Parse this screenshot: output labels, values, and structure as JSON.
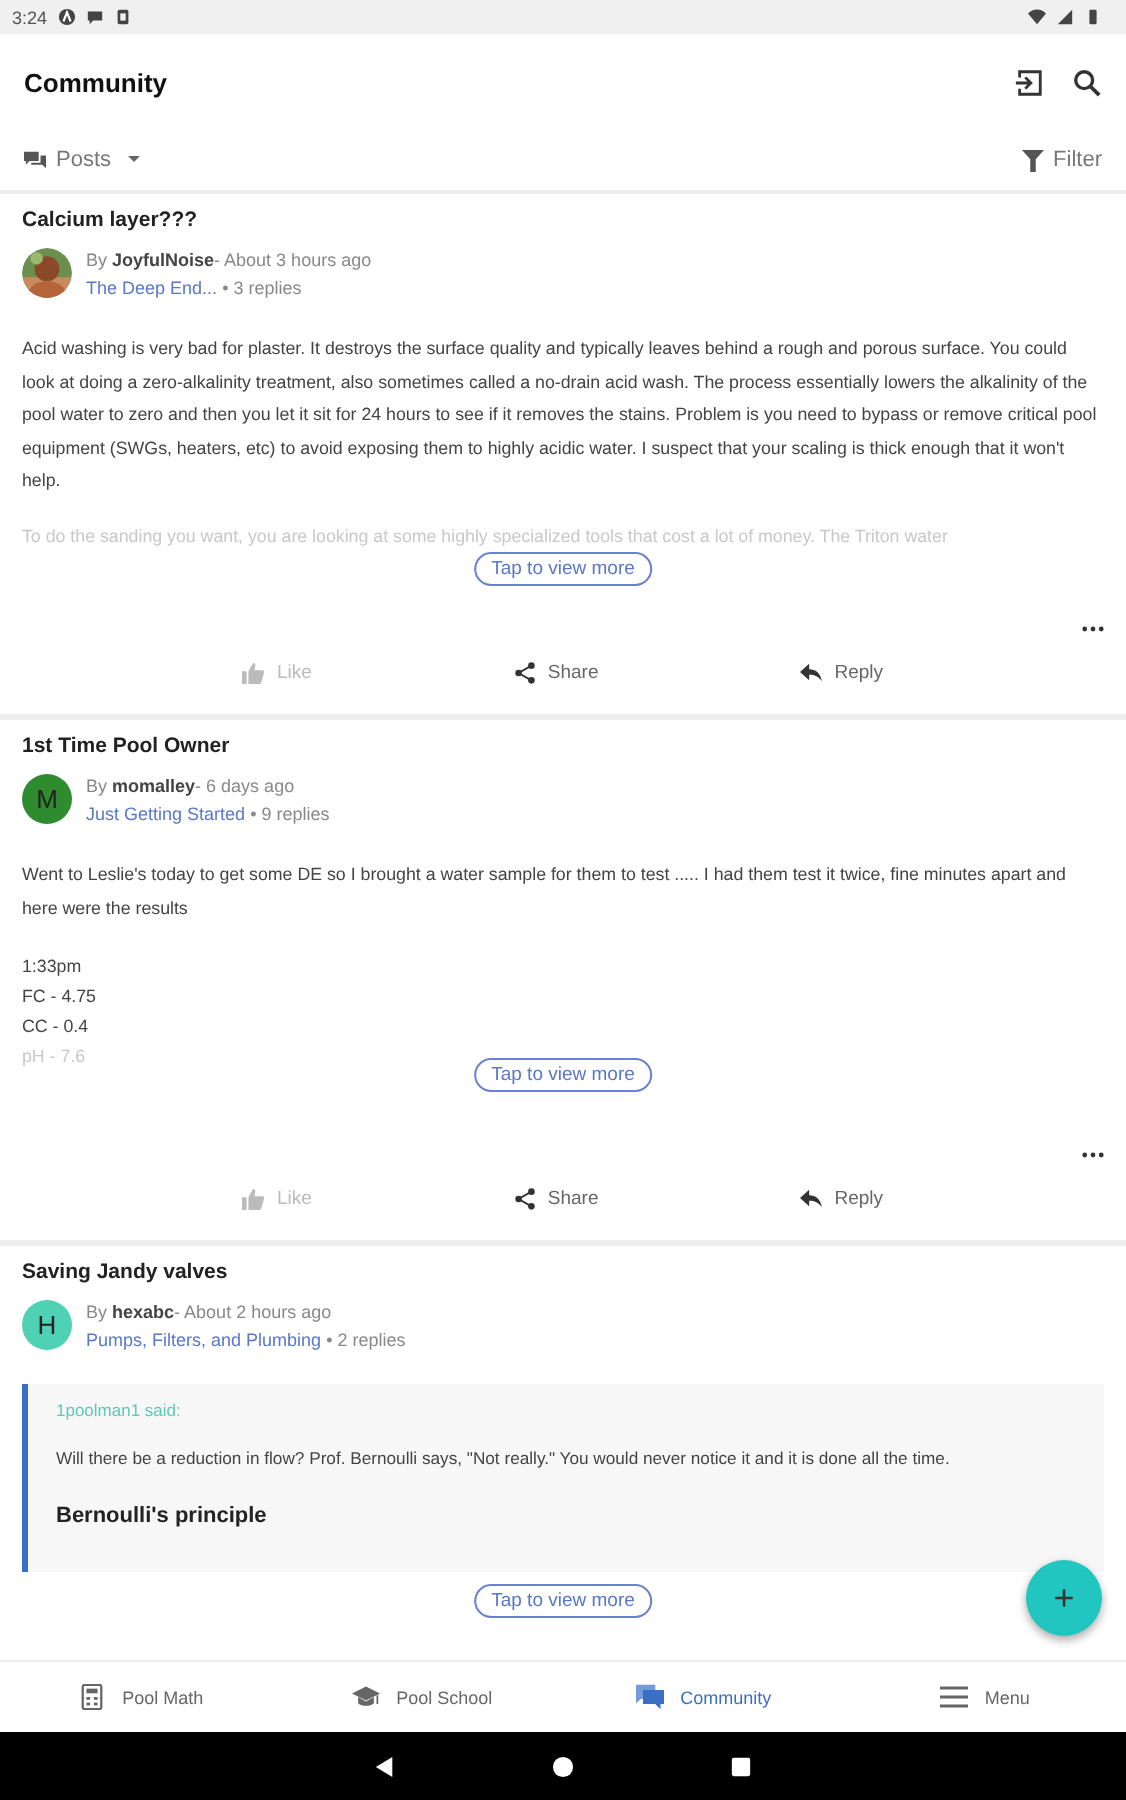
{
  "status_bar": {
    "time": "3:24"
  },
  "app_bar": {
    "title": "Community"
  },
  "filter_bar": {
    "view": "Posts",
    "filter": "Filter"
  },
  "posts": [
    {
      "title": "Calcium layer???",
      "avatar": {
        "kind": "picture"
      },
      "by": "By",
      "author": "JoyfulNoise",
      "time": "- About 3 hours ago",
      "category": "The Deep End...",
      "replies": "• 3 replies",
      "body": [
        "Acid washing is very bad for plaster. It destroys the surface quality and typically leaves behind a rough and porous surface. You could look at doing a zero-alkalinity treatment, also sometimes called a no-drain acid wash. The process essentially lowers the alkalinity of the pool water to zero and then you let it sit for 24 hours to see if it removes the stains. Problem is you need to bypass or remove critical pool equipment (SWGs, heaters, etc) to avoid exposing them to highly acidic water. I suspect that your scaling is thick enough that it won't help."
      ],
      "faded": [
        "To do the sanding you want, you are looking at some highly specialized tools that cost a lot of money. The Triton water"
      ],
      "view_more": "Tap to view more",
      "actions": [
        "Like",
        "Share",
        "Reply"
      ]
    },
    {
      "title": "1st Time Pool Owner",
      "avatar": {
        "kind": "letter",
        "letter": "M",
        "color": "#2e8b2e"
      },
      "by": "By",
      "author": "momalley",
      "time": "- 6 days ago",
      "category": "Just Getting Started",
      "replies": "• 9 replies",
      "body": [
        "Went to Leslie's today to get some DE so I brought a water sample for them to test ..... I had them test it twice, fine minutes apart and here were the results"
      ],
      "lines": [
        "1:33pm",
        "FC - 4.75",
        "CC - 0.4"
      ],
      "faded": [
        "pH - 7.6"
      ],
      "view_more": "Tap to view more",
      "actions": [
        "Like",
        "Share",
        "Reply"
      ]
    },
    {
      "title": "Saving Jandy valves",
      "avatar": {
        "kind": "letter",
        "letter": "H",
        "color": "#4fd1b5"
      },
      "by": "By",
      "author": "hexabc",
      "time": "- About 2 hours ago",
      "category": "Pumps, Filters, and Plumbing",
      "replies": "• 2 replies",
      "quote": {
        "said": "1poolman1 said:",
        "text": "Will there be a reduction in flow? Prof. Bernoulli says, \"Not really.\" You would never notice it and it is done all the time.",
        "heading": "Bernoulli's principle"
      },
      "view_more": "Tap to view more"
    }
  ],
  "fab": "+",
  "bottom_nav": [
    {
      "label": "Pool Math",
      "selected": false
    },
    {
      "label": "Pool School",
      "selected": false
    },
    {
      "label": "Community",
      "selected": true
    },
    {
      "label": "Menu",
      "selected": false
    }
  ]
}
